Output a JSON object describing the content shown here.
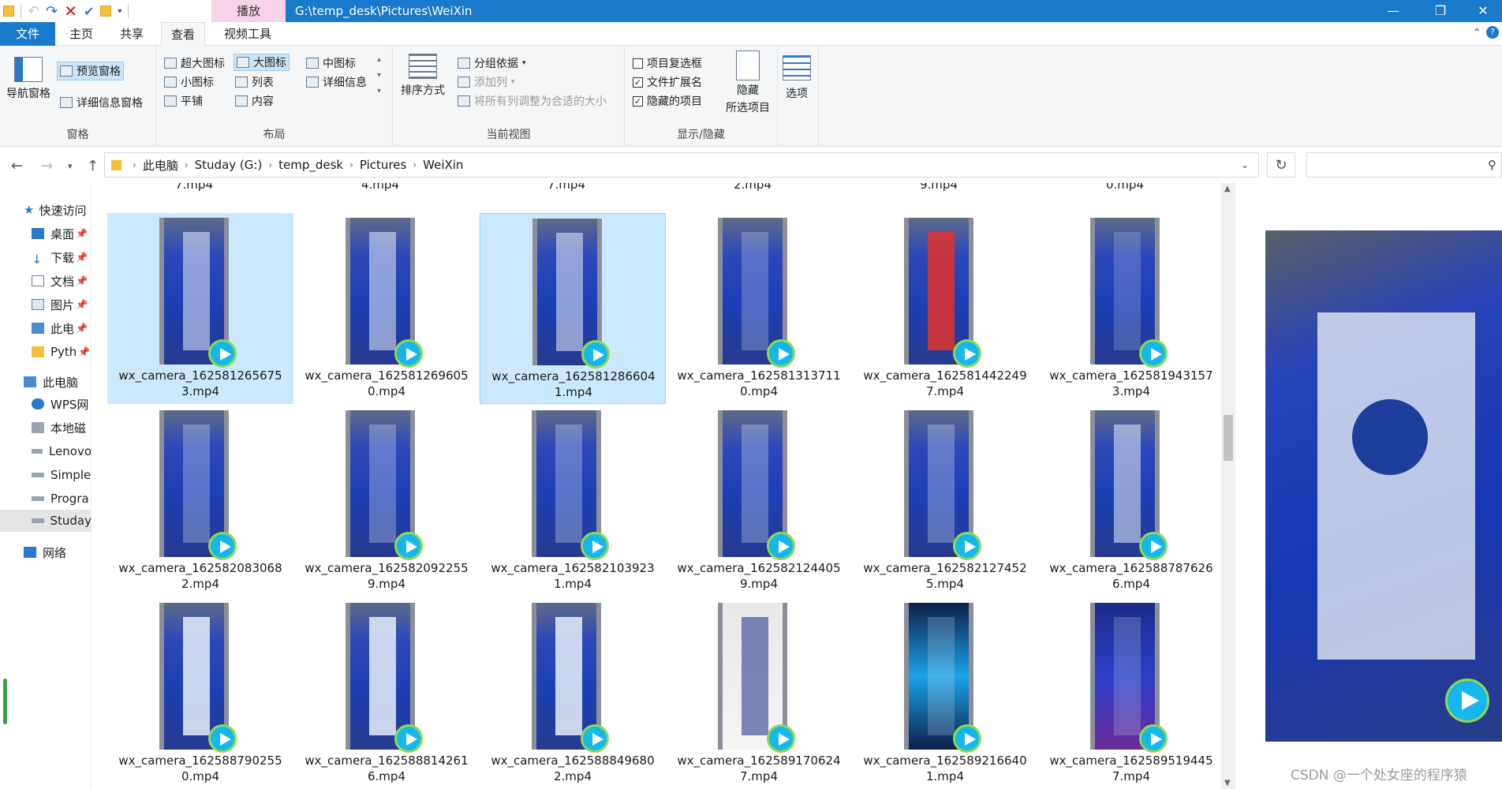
{
  "titlebar": {
    "context_tab": "播放",
    "path_title": "G:\\temp_desk\\Pictures\\WeiXin",
    "minimize": "—",
    "maximize": "❐",
    "close": "✕"
  },
  "tabs": {
    "file": "文件",
    "home": "主页",
    "share": "共享",
    "view": "查看",
    "video_tools": "视频工具"
  },
  "ribbon": {
    "panes": {
      "nav_pane": "导航窗格",
      "preview_pane": "预览窗格",
      "details_pane": "详细信息窗格",
      "label": "窗格"
    },
    "layout": {
      "extra_large": "超大图标",
      "large": "大图标",
      "medium": "中图标",
      "small": "小图标",
      "list": "列表",
      "details": "详细信息",
      "tiles": "平铺",
      "content": "内容",
      "label": "布局"
    },
    "current_view": {
      "sort_by": "排序方式",
      "group_by": "分组依据",
      "add_columns": "添加列",
      "size_all_columns": "将所有列调整为合适的大小",
      "label": "当前视图"
    },
    "show_hide": {
      "item_checkboxes": "项目复选框",
      "file_extensions": "文件扩展名",
      "hidden_items": "隐藏的项目",
      "hide_selected_1": "隐藏",
      "hide_selected_2": "所选项目",
      "label": "显示/隐藏"
    },
    "options": "选项"
  },
  "address": {
    "crumbs": [
      "此电脑",
      "Studay (G:)",
      "temp_desk",
      "Pictures",
      "WeiXin"
    ]
  },
  "nav": {
    "quick_access": "快速访问",
    "desktop": "桌面",
    "downloads": "下载",
    "documents": "文档",
    "pictures": "图片",
    "this_pc_short": "此电",
    "pyth": "Pyth",
    "this_pc": "此电脑",
    "wps": "WPS网",
    "local_disk": "本地磁",
    "lenovo": "Lenovo",
    "simple": "Simple",
    "progra": "Progra",
    "studay": "Studay",
    "network": "网络"
  },
  "top_partial_row": [
    "7.mp4",
    "4.mp4",
    "7.mp4",
    "2.mp4",
    "9.mp4",
    "0.mp4"
  ],
  "files": [
    {
      "l1": "wx_camera_162581265675",
      "l2": "3.mp4"
    },
    {
      "l1": "wx_camera_162581269605",
      "l2": "0.mp4"
    },
    {
      "l1": "wx_camera_162581286604",
      "l2": "1.mp4"
    },
    {
      "l1": "wx_camera_162581313711",
      "l2": "0.mp4"
    },
    {
      "l1": "wx_camera_162581442249",
      "l2": "7.mp4"
    },
    {
      "l1": "wx_camera_162581943157",
      "l2": "3.mp4"
    },
    {
      "l1": "wx_camera_162582083068",
      "l2": "2.mp4"
    },
    {
      "l1": "wx_camera_162582092255",
      "l2": "9.mp4"
    },
    {
      "l1": "wx_camera_162582103923",
      "l2": "1.mp4"
    },
    {
      "l1": "wx_camera_162582124405",
      "l2": "9.mp4"
    },
    {
      "l1": "wx_camera_162582127452",
      "l2": "5.mp4"
    },
    {
      "l1": "wx_camera_162588787626",
      "l2": "6.mp4"
    },
    {
      "l1": "wx_camera_162588790255",
      "l2": "0.mp4"
    },
    {
      "l1": "wx_camera_162588814261",
      "l2": "6.mp4"
    },
    {
      "l1": "wx_camera_162588849680",
      "l2": "2.mp4"
    },
    {
      "l1": "wx_camera_162589170624",
      "l2": "7.mp4"
    },
    {
      "l1": "wx_camera_162589216640",
      "l2": "1.mp4"
    },
    {
      "l1": "wx_camera_162589519445",
      "l2": "7.mp4"
    }
  ],
  "watermark": "CSDN @一个处女座的程序猿"
}
